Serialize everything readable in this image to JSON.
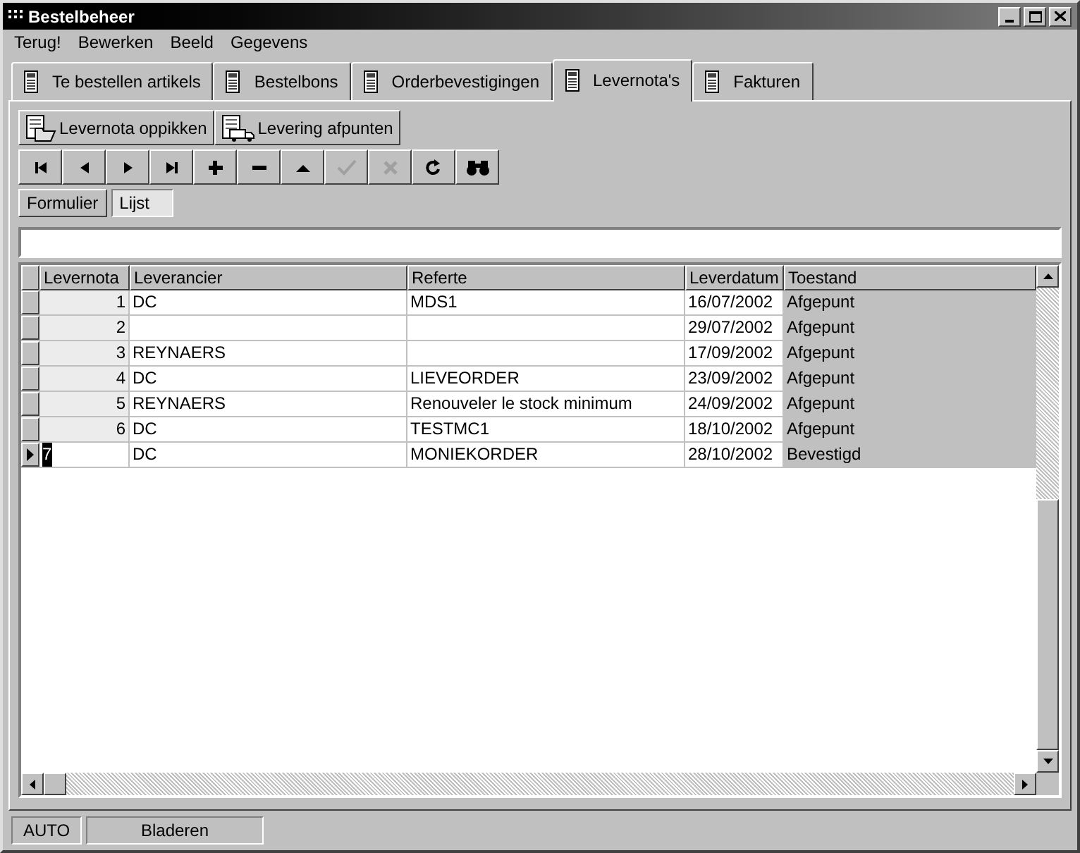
{
  "window": {
    "title": "Bestelbeheer"
  },
  "menu": [
    "Terug!",
    "Bewerken",
    "Beeld",
    "Gegevens"
  ],
  "tabs": [
    {
      "label": "Te bestellen artikels",
      "selected": false
    },
    {
      "label": "Bestelbons",
      "selected": false
    },
    {
      "label": "Orderbevestigingen",
      "selected": false
    },
    {
      "label": "Levernota's",
      "selected": true
    },
    {
      "label": "Fakturen",
      "selected": false
    }
  ],
  "actions": [
    {
      "label": "Levernota oppikken",
      "kind": "folder"
    },
    {
      "label": "Levering afpunten",
      "kind": "truck"
    }
  ],
  "navigator": [
    {
      "kind": "first",
      "disabled": false
    },
    {
      "kind": "prev",
      "disabled": false
    },
    {
      "kind": "next",
      "disabled": false
    },
    {
      "kind": "last",
      "disabled": false
    },
    {
      "kind": "add",
      "disabled": false
    },
    {
      "kind": "delete",
      "disabled": false
    },
    {
      "kind": "up",
      "disabled": false
    },
    {
      "kind": "confirm",
      "disabled": true
    },
    {
      "kind": "cancel",
      "disabled": true
    },
    {
      "kind": "refresh",
      "disabled": false
    },
    {
      "kind": "search",
      "disabled": false
    }
  ],
  "views": [
    {
      "label": "Formulier",
      "selected": false
    },
    {
      "label": "Lijst",
      "selected": true
    }
  ],
  "table": {
    "columns": [
      "Levernota",
      "Leverancier",
      "Referte",
      "Leverdatum",
      "Toestand"
    ],
    "rows": [
      {
        "cells": [
          "1",
          "DC",
          "MDS1",
          "16/07/2002",
          "Afgepunt"
        ],
        "selected": false
      },
      {
        "cells": [
          "2",
          "",
          "",
          "29/07/2002",
          "Afgepunt"
        ],
        "selected": false
      },
      {
        "cells": [
          "3",
          "REYNAERS",
          "",
          "17/09/2002",
          "Afgepunt"
        ],
        "selected": false
      },
      {
        "cells": [
          "4",
          "DC",
          "LIEVEORDER",
          "23/09/2002",
          "Afgepunt"
        ],
        "selected": false
      },
      {
        "cells": [
          "5",
          "REYNAERS",
          "Renouveler le stock minimum",
          "24/09/2002",
          "Afgepunt"
        ],
        "selected": false
      },
      {
        "cells": [
          "6",
          "DC",
          "TESTMC1",
          "18/10/2002",
          "Afgepunt"
        ],
        "selected": false
      },
      {
        "cells": [
          "7",
          "DC",
          "MONIEKORDER",
          "28/10/2002",
          "Bevestigd"
        ],
        "selected": true
      }
    ]
  },
  "status_bar": [
    "AUTO",
    "Bladeren"
  ]
}
